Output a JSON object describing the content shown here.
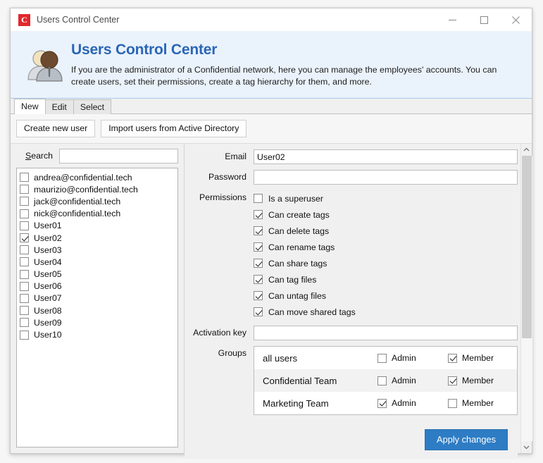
{
  "window": {
    "title": "Users Control Center",
    "app_icon_letter": "C",
    "controls": {
      "minimize": "minimize-icon",
      "maximize": "maximize-icon",
      "close": "close-icon"
    }
  },
  "banner": {
    "icon": "users-icon",
    "title": "Users Control Center",
    "description": "If you are the administrator of a Confidential network, here you can manage the employees' accounts. You can create users, set their permissions, create a tag hierarchy for them, and more.",
    "accent_color": "#2a66b5",
    "background_color": "#eaf2fb"
  },
  "tabs": [
    {
      "label": "New",
      "active": true
    },
    {
      "label": "Edit",
      "active": false
    },
    {
      "label": "Select",
      "active": false
    }
  ],
  "toolbar": {
    "buttons": [
      {
        "label": "Create new user"
      },
      {
        "label": "Import users from Active Directory"
      }
    ]
  },
  "left_panel": {
    "search": {
      "label_prefix": "S",
      "label_rest": "earch",
      "value": "",
      "placeholder": ""
    },
    "users": [
      {
        "label": "andrea@confidential.tech",
        "checked": false
      },
      {
        "label": "maurizio@confidential.tech",
        "checked": false
      },
      {
        "label": "jack@confidential.tech",
        "checked": false
      },
      {
        "label": "nick@confidential.tech",
        "checked": false
      },
      {
        "label": "User01",
        "checked": false
      },
      {
        "label": "User02",
        "checked": true
      },
      {
        "label": "User03",
        "checked": false
      },
      {
        "label": "User04",
        "checked": false
      },
      {
        "label": "User05",
        "checked": false
      },
      {
        "label": "User06",
        "checked": false
      },
      {
        "label": "User07",
        "checked": false
      },
      {
        "label": "User08",
        "checked": false
      },
      {
        "label": "User09",
        "checked": false
      },
      {
        "label": "User10",
        "checked": false
      }
    ]
  },
  "form": {
    "email": {
      "label": "Email",
      "value": "User02",
      "placeholder": ""
    },
    "password": {
      "label": "Password",
      "value": "",
      "placeholder": ""
    },
    "permissions_label": "Permissions",
    "permissions": [
      {
        "label": "Is a superuser",
        "checked": false
      },
      {
        "label": "Can create tags",
        "checked": true
      },
      {
        "label": "Can delete tags",
        "checked": true
      },
      {
        "label": "Can rename tags",
        "checked": true
      },
      {
        "label": "Can share tags",
        "checked": true
      },
      {
        "label": "Can tag files",
        "checked": true
      },
      {
        "label": "Can untag files",
        "checked": true
      },
      {
        "label": "Can move shared tags",
        "checked": true
      }
    ],
    "activation_key": {
      "label": "Activation key",
      "value": "",
      "placeholder": ""
    },
    "groups_label": "Groups",
    "groups": [
      {
        "name": "all users",
        "admin_label": "Admin",
        "admin": false,
        "member_label": "Member",
        "member": true
      },
      {
        "name": "Confidential Team",
        "admin_label": "Admin",
        "admin": false,
        "member_label": "Member",
        "member": true
      },
      {
        "name": "Marketing Team",
        "admin_label": "Admin",
        "admin": true,
        "member_label": "Member",
        "member": false
      }
    ]
  },
  "footer": {
    "apply_label": "Apply changes",
    "apply_color": "#2e7cc4"
  }
}
